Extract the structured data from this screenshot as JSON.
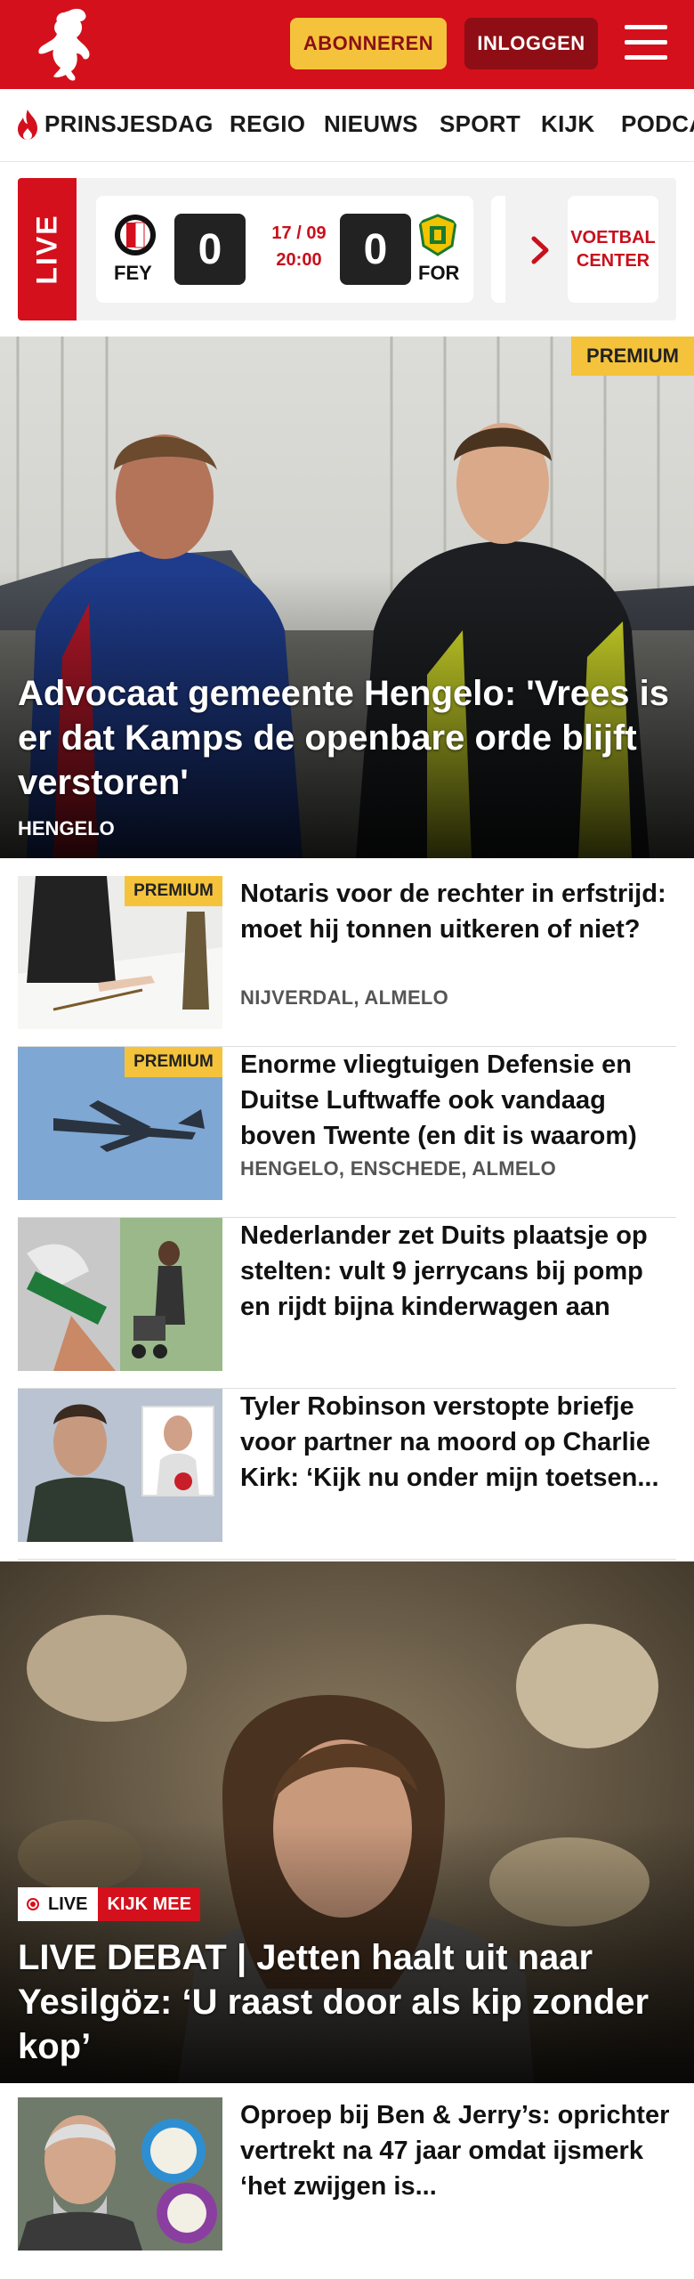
{
  "header": {
    "subscribe_label": "ABONNEREN",
    "login_label": "INLOGGEN"
  },
  "nav": {
    "items": [
      "PRINSJESDAG",
      "REGIO",
      "NIEUWS",
      "SPORT",
      "KIJK",
      "PODCA"
    ]
  },
  "live_scores": {
    "live_label": "LIVE",
    "match": {
      "home_code": "FEY",
      "away_code": "FOR",
      "home_score": "0",
      "away_score": "0",
      "date": "17 / 09",
      "time": "20:00"
    },
    "center_label_1": "VOETBAL",
    "center_label_2": "CENTER"
  },
  "hero": {
    "badge": "PREMIUM",
    "title": "Advocaat gemeente Hengelo: 'Vrees is er dat Kamps de openbare orde blijft verstoren'",
    "location": "HENGELO"
  },
  "articles": [
    {
      "badge": "PREMIUM",
      "title": "Notaris voor de rechter in erfstrijd: moet hij tonnen uitkeren of niet?",
      "location": "NIJVERDAL, ALMELO"
    },
    {
      "badge": "PREMIUM",
      "title": "Enorme vliegtuigen Defensie en Duitse Luftwaffe ook vandaag boven Twente (en dit is waarom)",
      "location": "HENGELO, ENSCHEDE, ALMELO"
    },
    {
      "title": "Nederlander zet Duits plaatsje op stelten: vult 9 jerrycans bij pomp en rijdt bijna kinderwagen aan"
    },
    {
      "title": "Tyler Robinson verstopte briefje voor partner na moord op Charlie Kirk: ‘Kijk nu onder mijn toetsen..."
    }
  ],
  "video_hero": {
    "live_label": "LIVE",
    "watch_label": "KIJK MEE",
    "title": "LIVE DEBAT | Jetten haalt uit naar Yesilgöz: ‘U raast door als kip zonder kop’"
  },
  "bottom_articles": [
    {
      "title": "Oproep bij Ben & Jerry’s: oprichter vertrekt na 47 jaar omdat ijsmerk ‘het zwijgen is..."
    }
  ],
  "colors": {
    "brand_red": "#d4101c",
    "premium_yellow": "#f5c33b"
  }
}
